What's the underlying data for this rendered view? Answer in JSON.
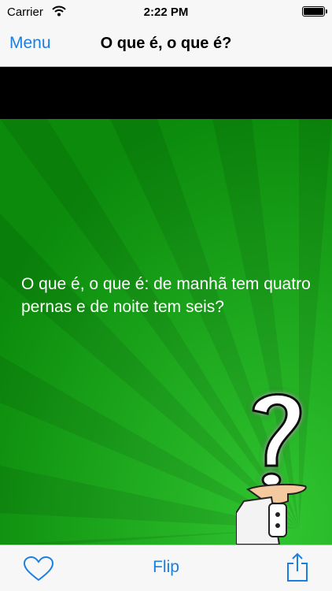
{
  "status_bar": {
    "carrier": "Carrier",
    "time": "2:22 PM"
  },
  "nav": {
    "menu_label": "Menu",
    "title": "O que é, o que é?"
  },
  "content": {
    "question": "O que é, o que é: de manhã tem quatro pernas e de noite tem seis?",
    "background_color": "#0a8f0a"
  },
  "toolbar": {
    "flip_label": "Flip",
    "favorite_icon": "heart-icon",
    "share_icon": "share-icon"
  },
  "colors": {
    "accent": "#1a7fe0"
  }
}
